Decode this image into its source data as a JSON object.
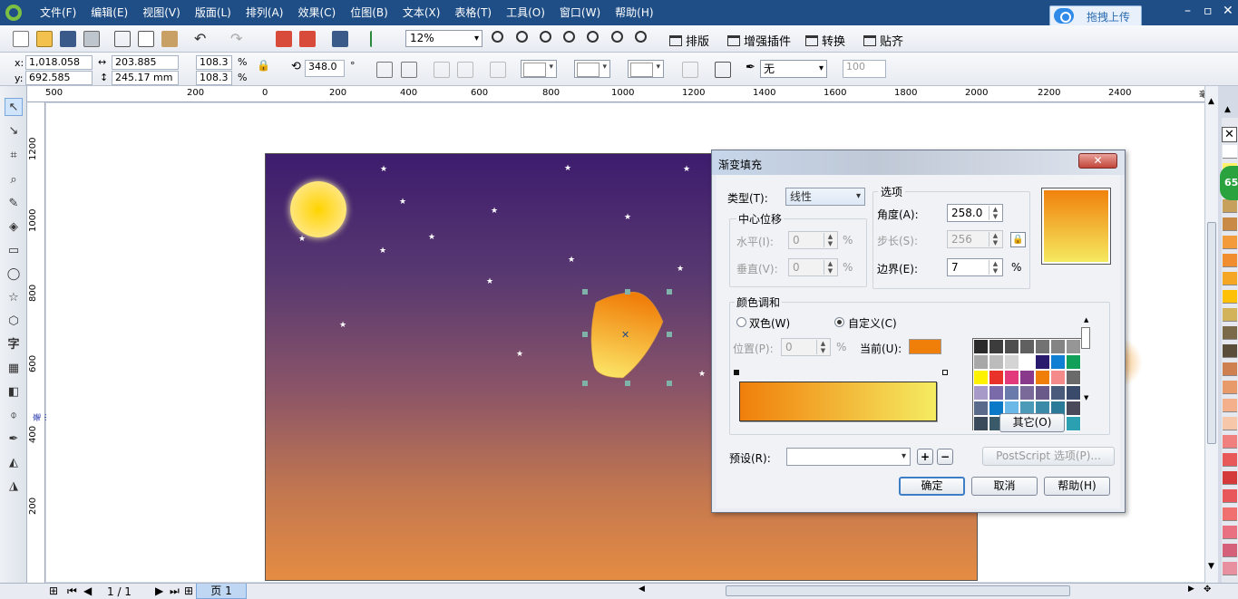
{
  "menu": [
    "文件(F)",
    "编辑(E)",
    "视图(V)",
    "版面(L)",
    "排列(A)",
    "效果(C)",
    "位图(B)",
    "文本(X)",
    "表格(T)",
    "工具(O)",
    "窗口(W)",
    "帮助(H)"
  ],
  "upload_label": "拖拽上传",
  "window_controls": {
    "minimize": "–",
    "restore": "▫",
    "close": "✕"
  },
  "toolbar": {
    "zoom": "12%",
    "plugins": [
      "排版",
      "增强插件",
      "转换",
      "贴齐"
    ]
  },
  "property_bar": {
    "x_label": "x:",
    "x": "1,018.058 mm",
    "y_label": "y:",
    "y": "692.585 mm",
    "width": "203.885 mm",
    "height": "245.17 mm",
    "scale_x": "108.3",
    "scale_y": "108.3",
    "percent": "%",
    "rotation": "348.0",
    "degree": "°",
    "outline": "无",
    "opacity": "100"
  },
  "ruler_h": [
    "500",
    "200",
    "0",
    "200",
    "400",
    "600",
    "800",
    "1000",
    "1200",
    "1400",
    "1600",
    "1800",
    "2000",
    "2200",
    "2400",
    "毫米"
  ],
  "ruler_v": [
    "1200",
    "1000",
    "800",
    "600",
    "400",
    "200"
  ],
  "ruler_v_unit": "毫米",
  "status": {
    "page_counter": "1 / 1",
    "page_tab": "页 1"
  },
  "palette_colors": [
    "#ffffff",
    "#fff26b",
    "#f7d86b",
    "#c7a05c",
    "#c98a46",
    "#f39b3b",
    "#f08d2e",
    "#f5a623",
    "#ffc107",
    "#d2b35a",
    "#7a6a4a",
    "#5a4e3a",
    "#cf8050",
    "#e89a6a",
    "#f4b08a",
    "#f7c7aa",
    "#f08080",
    "#e85a5a",
    "#d43a3a",
    "#e8585a",
    "#f07070",
    "#e87080",
    "#d4607a",
    "#e890a0"
  ],
  "cpu_badge": "65",
  "dialog": {
    "title": "渐变填充",
    "close_label": "✕",
    "type_label": "类型(T):",
    "type_value": "线性",
    "center_offset": "中心位移",
    "horizontal_label": "水平(I):",
    "horizontal_value": "0",
    "vertical_label": "垂直(V):",
    "vertical_value": "0",
    "options": "选项",
    "angle_label": "角度(A):",
    "angle_value": "258.0",
    "steps_label": "步长(S):",
    "steps_value": "256",
    "edge_label": "边界(E):",
    "edge_value": "7",
    "pct": "%",
    "color_blend": "颜色调和",
    "two_color": "双色(W)",
    "custom": "自定义(C)",
    "position_label": "位置(P):",
    "position_value": "0",
    "current_label": "当前(U):",
    "current_color": "#f07f0a",
    "gradient_start": "#f07f0a",
    "gradient_end": "#f5ec62",
    "other_btn": "其它(O)",
    "preset_label": "预设(R):",
    "postscript_btn": "PostScript 选项(P)...",
    "ok_btn": "确定",
    "cancel_btn": "取消",
    "help_btn": "帮助(H)",
    "swatches": [
      "#2a2a2a",
      "#3c3c3c",
      "#4e4e4e",
      "#606060",
      "#727272",
      "#848484",
      "#969696",
      "#a8a8a8",
      "#bcbcbc",
      "#d4d4d4",
      "#ffffff",
      "#2a1a6e",
      "#0e7fd2",
      "#11a05a",
      "#fff200",
      "#e8322a",
      "#e23a7a",
      "#8a3a8a",
      "#f07f0a",
      "#f48a8a",
      "#6a6a6a",
      "#a89ac8",
      "#7a6aaa",
      "#6a7aaa",
      "#7a6a9a",
      "#6a5a8a",
      "#4a5a7a",
      "#3a4a6a",
      "#5a6a8a",
      "#0a7ac8",
      "#6ab8e8",
      "#4a9ab8",
      "#3a8aa8",
      "#2a7a98",
      "#4a4a5a",
      "#3a4a5a",
      "#3a5a6a",
      "#2a6a6a",
      "#2a7a7a",
      "#3a8a8a",
      "#0aa8c8",
      "#2aa0b0"
    ]
  }
}
